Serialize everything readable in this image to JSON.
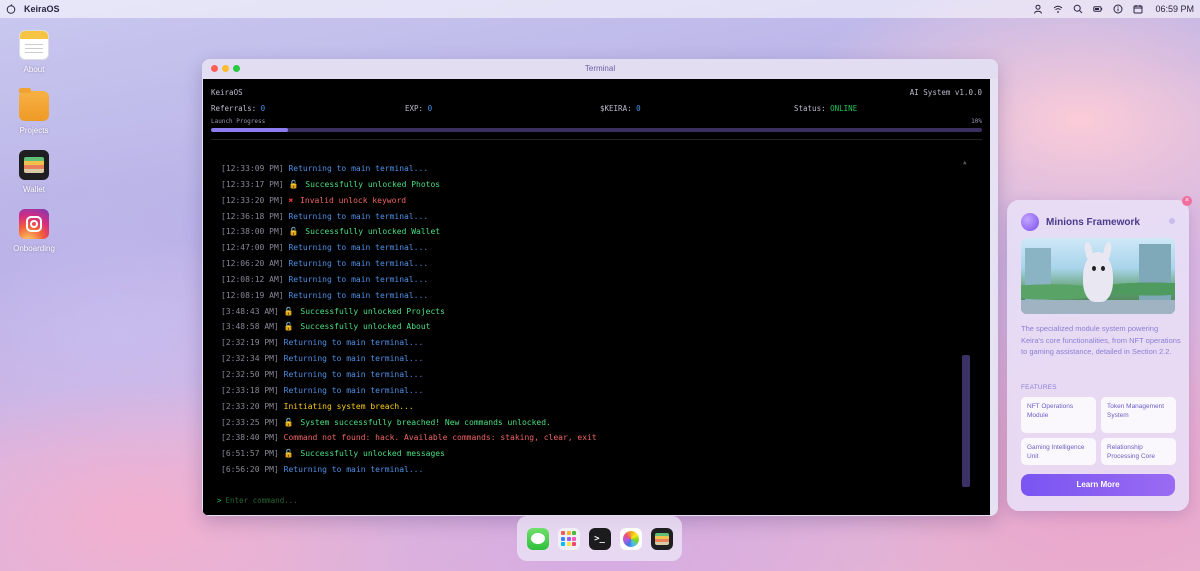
{
  "menubar": {
    "brand": "KeiraOS",
    "clock": "06:59 PM",
    "icons": [
      "user-icon",
      "wifi-icon",
      "search-icon",
      "battery-icon",
      "info-icon",
      "calendar-icon"
    ]
  },
  "desktop": {
    "icons": [
      {
        "label": "About",
        "icon": "notes-icon"
      },
      {
        "label": "Projects",
        "icon": "folder-icon"
      },
      {
        "label": "Wallet",
        "icon": "wallet-icon"
      },
      {
        "label": "Onboarding",
        "icon": "instagram-icon"
      }
    ]
  },
  "terminal": {
    "window_title": "Terminal",
    "os_name": "KeiraOS",
    "version": "AI System v1.0.0",
    "referrals_label": "Referrals:",
    "referrals_value": "0",
    "exp_label": "EXP:",
    "exp_value": "0",
    "keira_label": "$KEIRA:",
    "keira_value": "0",
    "status_label": "Status:",
    "status_value": "ONLINE",
    "progress_label": "Launch Progress",
    "progress_text": "10%",
    "progress_value": 0.1,
    "prompt_symbol": ">",
    "input_placeholder": "Enter command...",
    "log": [
      {
        "time": "[12:33:09 PM]",
        "text": "Returning to main terminal...",
        "kind": "info"
      },
      {
        "time": "[12:33:17 PM]",
        "text": "Successfully unlocked Photos",
        "kind": "success"
      },
      {
        "time": "[12:33:20 PM]",
        "text": "Invalid unlock keyword",
        "kind": "fail"
      },
      {
        "time": "[12:36:18 PM]",
        "text": "Returning to main terminal...",
        "kind": "info"
      },
      {
        "time": "[12:38:00 PM]",
        "text": "Successfully unlocked Wallet",
        "kind": "success"
      },
      {
        "time": "[12:47:00 PM]",
        "text": "Returning to main terminal...",
        "kind": "info"
      },
      {
        "time": "[12:06:20 AM]",
        "text": "Returning to main terminal...",
        "kind": "info"
      },
      {
        "time": "[12:08:12 AM]",
        "text": "Returning to main terminal...",
        "kind": "info"
      },
      {
        "time": "[12:08:19 AM]",
        "text": "Returning to main terminal...",
        "kind": "info"
      },
      {
        "time": "[3:48:43 AM]",
        "text": "Successfully unlocked Projects",
        "kind": "success"
      },
      {
        "time": "[3:48:58 AM]",
        "text": "Successfully unlocked About",
        "kind": "success"
      },
      {
        "time": "[2:32:19 PM]",
        "text": "Returning to main terminal...",
        "kind": "info"
      },
      {
        "time": "[2:32:34 PM]",
        "text": "Returning to main terminal...",
        "kind": "info"
      },
      {
        "time": "[2:32:50 PM]",
        "text": "Returning to main terminal...",
        "kind": "info"
      },
      {
        "time": "[2:33:18 PM]",
        "text": "Returning to main terminal...",
        "kind": "info"
      },
      {
        "time": "[2:33:20 PM]",
        "text": "Initiating system breach...",
        "kind": "warn"
      },
      {
        "time": "[2:33:25 PM]",
        "text": "System successfully breached! New commands unlocked.",
        "kind": "success"
      },
      {
        "time": "[2:38:40 PM]",
        "text": "Command not found: hack. Available commands: staking, clear, exit",
        "kind": "error"
      },
      {
        "time": "[6:51:57 PM]",
        "text": "Successfully unlocked messages",
        "kind": "success"
      },
      {
        "time": "[6:56:20 PM]",
        "text": "Returning to main terminal...",
        "kind": "info"
      }
    ]
  },
  "dock": {
    "apps": [
      "messages-icon",
      "launchpad-icon",
      "terminal-icon",
      "photos-icon",
      "wallet-icon"
    ],
    "terminal_glyph": ">_"
  },
  "panel": {
    "title": "Minions Framework",
    "description": "The specialized module system powering Keira's core functionalities, from NFT operations to gaming assistance, detailed in Section 2.2.",
    "features_label": "FEATURES",
    "features": [
      "NFT Operations Module",
      "Token Management System",
      "Gaming Intelligence Unit",
      "Relationship Processing Core"
    ],
    "button_label": "Learn More",
    "close_glyph": "×"
  },
  "colors": {
    "accent": "#7a55f2",
    "info": "#4f8fe6",
    "success": "#4ade80",
    "error": "#f06464",
    "warn": "#facc15",
    "online": "#22c55e"
  }
}
